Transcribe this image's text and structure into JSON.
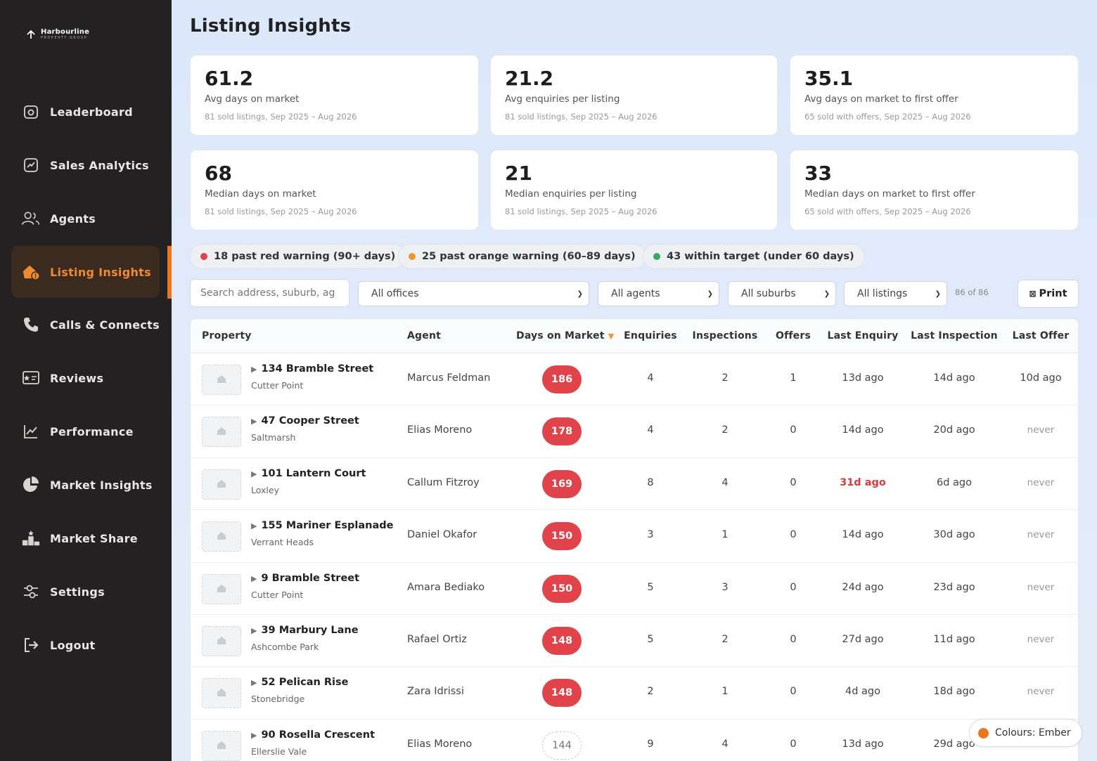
{
  "brand": {
    "name": "Harbourline",
    "sub": "PROPERTY GROUP"
  },
  "nav": [
    {
      "label": "Leaderboard",
      "icon": "leaderboard-icon"
    },
    {
      "label": "Sales Analytics",
      "icon": "sales-analytics-icon"
    },
    {
      "label": "Agents",
      "icon": "agents-icon"
    },
    {
      "label": "Listing Insights",
      "icon": "listing-insights-icon",
      "active": true
    },
    {
      "label": "Calls & Connects",
      "icon": "phone-icon"
    },
    {
      "label": "Reviews",
      "icon": "reviews-icon"
    },
    {
      "label": "Performance",
      "icon": "performance-icon"
    },
    {
      "label": "Market Insights",
      "icon": "pie-chart-icon"
    },
    {
      "label": "Market Share",
      "icon": "market-share-icon"
    },
    {
      "label": "Settings",
      "icon": "settings-icon"
    },
    {
      "label": "Logout",
      "icon": "logout-icon"
    }
  ],
  "page": {
    "title": "Listing Insights"
  },
  "cards": [
    {
      "value": "61.2",
      "label": "Avg days on market",
      "sub": "81 sold listings, Sep 2025 – Aug 2026"
    },
    {
      "value": "21.2",
      "label": "Avg enquiries per listing",
      "sub": "81 sold listings, Sep 2025 – Aug 2026"
    },
    {
      "value": "35.1",
      "label": "Avg days on market to first offer",
      "sub": "65 sold with offers, Sep 2025 – Aug 2026"
    },
    {
      "value": "68",
      "label": "Median days on market",
      "sub": "81 sold listings, Sep 2025 – Aug 2026"
    },
    {
      "value": "21",
      "label": "Median enquiries per listing",
      "sub": "81 sold listings, Sep 2025 – Aug 2026"
    },
    {
      "value": "33",
      "label": "Median days on market to first offer",
      "sub": "65 sold with offers, Sep 2025 – Aug 2026"
    }
  ],
  "pills": [
    {
      "label": "18 past red warning (90+ days)",
      "color": "#e0434a"
    },
    {
      "label": "25 past orange warning (60–89 days)",
      "color": "#f0962e"
    },
    {
      "label": "43 within target (under 60 days)",
      "color": "#3aa56b"
    }
  ],
  "filters": {
    "search_placeholder": "Search address, suburb, ag",
    "office": "All offices",
    "agent": "All agents",
    "suburb": "All suburbs",
    "listing": "All listings",
    "count": "86 of 86",
    "print_label": "Print"
  },
  "table": {
    "headers": [
      "Property",
      "Agent",
      "Days on Market",
      "Enquiries",
      "Inspections",
      "Offers",
      "Last Enquiry",
      "Last Inspection",
      "Last Offer"
    ],
    "rows": [
      {
        "address": "134 Bramble Street",
        "suburb": "Cutter Point",
        "agent": "Marcus Feldman",
        "dom": "186",
        "status": "red",
        "enquiries": "4",
        "inspections": "2",
        "offers": "1",
        "last_enquiry": "13d ago",
        "last_inspection": "14d ago",
        "last_offer": "10d ago"
      },
      {
        "address": "47 Cooper Street",
        "suburb": "Saltmarsh",
        "agent": "Elias Moreno",
        "dom": "178",
        "status": "red",
        "enquiries": "4",
        "inspections": "2",
        "offers": "0",
        "last_enquiry": "14d ago",
        "last_inspection": "20d ago",
        "last_offer": "never"
      },
      {
        "address": "101 Lantern Court",
        "suburb": "Loxley",
        "agent": "Callum Fitzroy",
        "dom": "169",
        "status": "red",
        "enquiries": "8",
        "inspections": "4",
        "offers": "0",
        "last_enquiry": "31d ago",
        "last_enquiry_hot": true,
        "last_inspection": "6d ago",
        "last_offer": "never"
      },
      {
        "address": "155 Mariner Esplanade",
        "suburb": "Verrant Heads",
        "agent": "Daniel Okafor",
        "dom": "150",
        "status": "red",
        "enquiries": "3",
        "inspections": "1",
        "offers": "0",
        "last_enquiry": "14d ago",
        "last_inspection": "30d ago",
        "last_offer": "never"
      },
      {
        "address": "9 Bramble Street",
        "suburb": "Cutter Point",
        "agent": "Amara Bediako",
        "dom": "150",
        "status": "red",
        "enquiries": "5",
        "inspections": "3",
        "offers": "0",
        "last_enquiry": "24d ago",
        "last_inspection": "23d ago",
        "last_offer": "never"
      },
      {
        "address": "39 Marbury Lane",
        "suburb": "Ashcombe Park",
        "agent": "Rafael Ortiz",
        "dom": "148",
        "status": "red",
        "enquiries": "5",
        "inspections": "2",
        "offers": "0",
        "last_enquiry": "27d ago",
        "last_inspection": "11d ago",
        "last_offer": "never"
      },
      {
        "address": "52 Pelican Rise",
        "suburb": "Stonebridge",
        "agent": "Zara Idrissi",
        "dom": "148",
        "status": "red",
        "enquiries": "2",
        "inspections": "1",
        "offers": "0",
        "last_enquiry": "4d ago",
        "last_inspection": "18d ago",
        "last_offer": "never"
      },
      {
        "address": "90 Rosella Crescent",
        "suburb": "Ellerslie Vale",
        "agent": "Elias Moreno",
        "dom": "144",
        "status": "plain",
        "enquiries": "9",
        "inspections": "4",
        "offers": "0",
        "last_enquiry": "13d ago",
        "last_inspection": "29d ago",
        "last_offer": ""
      }
    ]
  },
  "theme": {
    "label": "Colours: Ember",
    "color": "#e7781f"
  }
}
